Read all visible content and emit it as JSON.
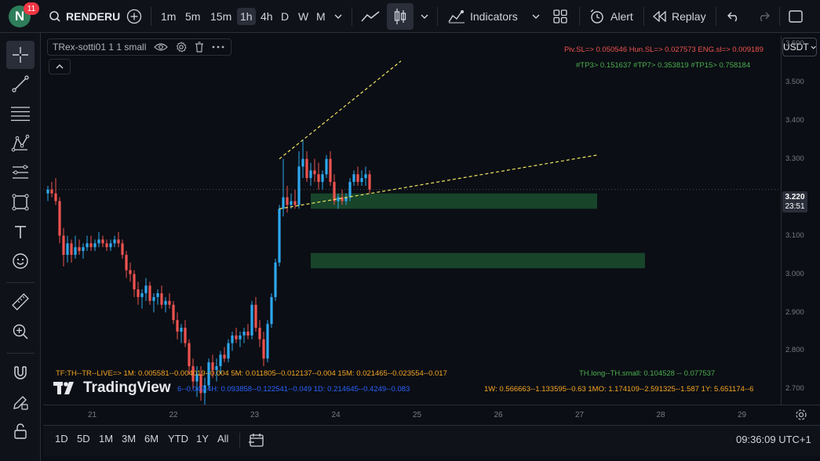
{
  "header": {
    "avatar_letter": "N",
    "notification_count": "11",
    "symbol": "RENDERU",
    "intervals": [
      "1m",
      "5m",
      "15m",
      "1h",
      "4h",
      "D",
      "W",
      "M"
    ],
    "active_interval": "1h",
    "indicators_label": "Indicators",
    "alert_label": "Alert",
    "replay_label": "Replay"
  },
  "legend": {
    "title": "TRex-sotti01 1 1 small"
  },
  "currency": "USDT",
  "price_axis": {
    "labels": [
      "3.600",
      "3.500",
      "3.400",
      "3.300",
      "3.100",
      "3.000",
      "2.900",
      "2.800",
      "2.700"
    ],
    "current_price": "3.220",
    "countdown": "23:51"
  },
  "time_axis": {
    "labels": [
      "21",
      "22",
      "23",
      "24",
      "25",
      "26",
      "27",
      "28",
      "29"
    ]
  },
  "indicator_text": {
    "top_red": "Piv.SL=> 0.050546  Hun.SL=> 0.027573  ENG.sl=> 0.009189",
    "top_green": "#TP3> 0.151637  #TP7> 0.353819  #TP15> 0.758184",
    "tf_line": "TF:TH--TR--LIVE=>   1M: 0.005581--0.004019--0.004   5M: 0.011805--0.012137--0.004   15M: 0.021465--0.023554--0.017",
    "th_line": "TH.long--TH.small: 0.104528 -- 0.077537",
    "row2_blue": "6--0.049   4H: 0.093858--0.122541--0.049   1D: 0.214645--0.4249--0.083",
    "row2_orange": "1W: 0.566663--1.133595--0.63   1MO: 1.174109--2.591325--1.587   1Y: 5.651174--6"
  },
  "watermark": "TradingView",
  "bottom": {
    "ranges": [
      "1D",
      "5D",
      "1M",
      "3M",
      "6M",
      "YTD",
      "1Y",
      "All"
    ],
    "clock": "09:36:09 UTC+1"
  },
  "colors": {
    "up": "#26a69a",
    "up_bright": "#2ea8f0",
    "down": "#ef5350",
    "zone": "#1b4d2e",
    "trendline": "#f5e663",
    "bg": "#0b0e14"
  },
  "chart_data": {
    "type": "candlestick",
    "x_labels": [
      "21",
      "22",
      "23",
      "24",
      "25",
      "26",
      "27",
      "28",
      "29"
    ],
    "ylim": [
      2.66,
      3.62
    ],
    "current_price": 3.22,
    "candles": [
      {
        "o": 3.21,
        "h": 3.23,
        "l": 3.19,
        "c": 3.22
      },
      {
        "o": 3.22,
        "h": 3.24,
        "l": 3.2,
        "c": 3.21
      },
      {
        "o": 3.21,
        "h": 3.25,
        "l": 3.18,
        "c": 3.19
      },
      {
        "o": 3.19,
        "h": 3.2,
        "l": 3.08,
        "c": 3.1
      },
      {
        "o": 3.1,
        "h": 3.12,
        "l": 3.02,
        "c": 3.05
      },
      {
        "o": 3.05,
        "h": 3.1,
        "l": 3.03,
        "c": 3.08
      },
      {
        "o": 3.08,
        "h": 3.09,
        "l": 3.03,
        "c": 3.05
      },
      {
        "o": 3.05,
        "h": 3.1,
        "l": 3.04,
        "c": 3.07
      },
      {
        "o": 3.07,
        "h": 3.09,
        "l": 3.05,
        "c": 3.06
      },
      {
        "o": 3.06,
        "h": 3.08,
        "l": 3.04,
        "c": 3.07
      },
      {
        "o": 3.07,
        "h": 3.1,
        "l": 3.06,
        "c": 3.08
      },
      {
        "o": 3.08,
        "h": 3.1,
        "l": 3.06,
        "c": 3.07
      },
      {
        "o": 3.07,
        "h": 3.09,
        "l": 3.06,
        "c": 3.08
      },
      {
        "o": 3.08,
        "h": 3.11,
        "l": 3.07,
        "c": 3.09
      },
      {
        "o": 3.09,
        "h": 3.1,
        "l": 3.07,
        "c": 3.08
      },
      {
        "o": 3.08,
        "h": 3.09,
        "l": 3.06,
        "c": 3.07
      },
      {
        "o": 3.07,
        "h": 3.09,
        "l": 3.06,
        "c": 3.08
      },
      {
        "o": 3.08,
        "h": 3.1,
        "l": 3.07,
        "c": 3.09
      },
      {
        "o": 3.09,
        "h": 3.11,
        "l": 3.07,
        "c": 3.08
      },
      {
        "o": 3.08,
        "h": 3.09,
        "l": 3.04,
        "c": 3.05
      },
      {
        "o": 3.05,
        "h": 3.06,
        "l": 2.99,
        "c": 3.01
      },
      {
        "o": 3.01,
        "h": 3.03,
        "l": 2.98,
        "c": 3.0
      },
      {
        "o": 3.0,
        "h": 3.01,
        "l": 2.94,
        "c": 2.96
      },
      {
        "o": 2.96,
        "h": 2.98,
        "l": 2.92,
        "c": 2.94
      },
      {
        "o": 2.94,
        "h": 2.96,
        "l": 2.91,
        "c": 2.95
      },
      {
        "o": 2.95,
        "h": 2.99,
        "l": 2.93,
        "c": 2.97
      },
      {
        "o": 2.97,
        "h": 2.98,
        "l": 2.92,
        "c": 2.93
      },
      {
        "o": 2.93,
        "h": 2.95,
        "l": 2.9,
        "c": 2.94
      },
      {
        "o": 2.94,
        "h": 2.96,
        "l": 2.92,
        "c": 2.95
      },
      {
        "o": 2.95,
        "h": 2.97,
        "l": 2.91,
        "c": 2.92
      },
      {
        "o": 2.92,
        "h": 2.94,
        "l": 2.9,
        "c": 2.93
      },
      {
        "o": 2.93,
        "h": 2.95,
        "l": 2.91,
        "c": 2.92
      },
      {
        "o": 2.92,
        "h": 2.93,
        "l": 2.87,
        "c": 2.88
      },
      {
        "o": 2.88,
        "h": 2.9,
        "l": 2.83,
        "c": 2.85
      },
      {
        "o": 2.85,
        "h": 2.87,
        "l": 2.82,
        "c": 2.86
      },
      {
        "o": 2.86,
        "h": 2.88,
        "l": 2.81,
        "c": 2.82
      },
      {
        "o": 2.82,
        "h": 2.83,
        "l": 2.74,
        "c": 2.76
      },
      {
        "o": 2.76,
        "h": 2.78,
        "l": 2.7,
        "c": 2.72
      },
      {
        "o": 2.72,
        "h": 2.76,
        "l": 2.68,
        "c": 2.74
      },
      {
        "o": 2.74,
        "h": 2.76,
        "l": 2.67,
        "c": 2.69
      },
      {
        "o": 2.69,
        "h": 2.73,
        "l": 2.66,
        "c": 2.71
      },
      {
        "o": 2.71,
        "h": 2.78,
        "l": 2.7,
        "c": 2.77
      },
      {
        "o": 2.77,
        "h": 2.79,
        "l": 2.73,
        "c": 2.75
      },
      {
        "o": 2.75,
        "h": 2.78,
        "l": 2.72,
        "c": 2.76
      },
      {
        "o": 2.76,
        "h": 2.8,
        "l": 2.74,
        "c": 2.79
      },
      {
        "o": 2.79,
        "h": 2.81,
        "l": 2.77,
        "c": 2.78
      },
      {
        "o": 2.78,
        "h": 2.83,
        "l": 2.77,
        "c": 2.82
      },
      {
        "o": 2.82,
        "h": 2.85,
        "l": 2.8,
        "c": 2.84
      },
      {
        "o": 2.84,
        "h": 2.86,
        "l": 2.82,
        "c": 2.83
      },
      {
        "o": 2.83,
        "h": 2.85,
        "l": 2.81,
        "c": 2.84
      },
      {
        "o": 2.84,
        "h": 2.86,
        "l": 2.82,
        "c": 2.85
      },
      {
        "o": 2.85,
        "h": 2.87,
        "l": 2.83,
        "c": 2.84
      },
      {
        "o": 2.84,
        "h": 2.93,
        "l": 2.83,
        "c": 2.92
      },
      {
        "o": 2.92,
        "h": 2.94,
        "l": 2.85,
        "c": 2.86
      },
      {
        "o": 2.86,
        "h": 2.88,
        "l": 2.81,
        "c": 2.83
      },
      {
        "o": 2.83,
        "h": 2.85,
        "l": 2.76,
        "c": 2.78
      },
      {
        "o": 2.78,
        "h": 2.88,
        "l": 2.77,
        "c": 2.87
      },
      {
        "o": 2.87,
        "h": 2.95,
        "l": 2.86,
        "c": 2.94
      },
      {
        "o": 2.94,
        "h": 3.04,
        "l": 2.93,
        "c": 3.03
      },
      {
        "o": 3.03,
        "h": 3.18,
        "l": 3.02,
        "c": 3.17
      },
      {
        "o": 3.17,
        "h": 3.3,
        "l": 3.15,
        "c": 3.2
      },
      {
        "o": 3.2,
        "h": 3.23,
        "l": 3.16,
        "c": 3.18
      },
      {
        "o": 3.18,
        "h": 3.21,
        "l": 3.17,
        "c": 3.19
      },
      {
        "o": 3.19,
        "h": 3.22,
        "l": 3.17,
        "c": 3.18
      },
      {
        "o": 3.18,
        "h": 3.32,
        "l": 3.17,
        "c": 3.28
      },
      {
        "o": 3.28,
        "h": 3.35,
        "l": 3.25,
        "c": 3.3
      },
      {
        "o": 3.3,
        "h": 3.32,
        "l": 3.24,
        "c": 3.25
      },
      {
        "o": 3.25,
        "h": 3.29,
        "l": 3.23,
        "c": 3.27
      },
      {
        "o": 3.27,
        "h": 3.3,
        "l": 3.24,
        "c": 3.26
      },
      {
        "o": 3.26,
        "h": 3.29,
        "l": 3.22,
        "c": 3.24
      },
      {
        "o": 3.24,
        "h": 3.27,
        "l": 3.22,
        "c": 3.26
      },
      {
        "o": 3.26,
        "h": 3.31,
        "l": 3.25,
        "c": 3.3
      },
      {
        "o": 3.3,
        "h": 3.32,
        "l": 3.23,
        "c": 3.24
      },
      {
        "o": 3.24,
        "h": 3.26,
        "l": 3.18,
        "c": 3.19
      },
      {
        "o": 3.19,
        "h": 3.21,
        "l": 3.17,
        "c": 3.2
      },
      {
        "o": 3.2,
        "h": 3.22,
        "l": 3.18,
        "c": 3.19
      },
      {
        "o": 3.19,
        "h": 3.21,
        "l": 3.18,
        "c": 3.2
      },
      {
        "o": 3.2,
        "h": 3.25,
        "l": 3.19,
        "c": 3.24
      },
      {
        "o": 3.24,
        "h": 3.27,
        "l": 3.23,
        "c": 3.26
      },
      {
        "o": 3.26,
        "h": 3.28,
        "l": 3.23,
        "c": 3.24
      },
      {
        "o": 3.24,
        "h": 3.27,
        "l": 3.23,
        "c": 3.25
      },
      {
        "o": 3.25,
        "h": 3.28,
        "l": 3.23,
        "c": 3.26
      },
      {
        "o": 3.26,
        "h": 3.27,
        "l": 3.21,
        "c": 3.22
      }
    ],
    "zones": [
      {
        "low": 3.17,
        "high": 3.21
      },
      {
        "low": 3.015,
        "high": 3.055
      }
    ],
    "trendlines": [
      {
        "from": [
          59,
          3.3
        ],
        "to": [
          90,
          3.555
        ]
      },
      {
        "from": [
          59,
          3.17
        ],
        "to": [
          140,
          3.31
        ]
      }
    ]
  }
}
